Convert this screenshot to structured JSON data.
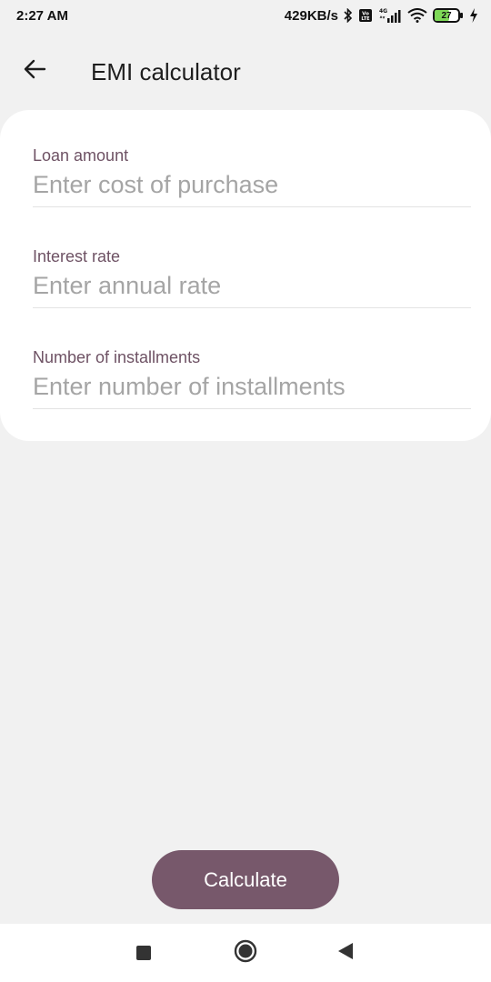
{
  "status_bar": {
    "time": "2:27 AM",
    "network_speed": "429KB/s",
    "battery_level": "27",
    "icons": [
      "bluetooth-icon",
      "volte-icon",
      "signal-4g-icon",
      "wifi-icon",
      "battery-icon",
      "charging-icon"
    ]
  },
  "app_bar": {
    "title": "EMI calculator",
    "back_icon": "arrow-left-icon"
  },
  "form": {
    "loan_amount": {
      "label": "Loan amount",
      "placeholder": "Enter cost of purchase",
      "value": ""
    },
    "interest_rate": {
      "label": "Interest rate",
      "placeholder": "Enter annual rate",
      "value": ""
    },
    "installments": {
      "label": "Number of installments",
      "placeholder": "Enter number of installments",
      "value": ""
    }
  },
  "actions": {
    "calculate_label": "Calculate"
  },
  "colors": {
    "background": "#f1f1f1",
    "card": "#ffffff",
    "accent": "#77586b",
    "label": "#6e5264",
    "placeholder": "#a5a5a5"
  },
  "nav_bar": {
    "icons": [
      "recent-apps-icon",
      "home-icon",
      "back-icon"
    ]
  }
}
